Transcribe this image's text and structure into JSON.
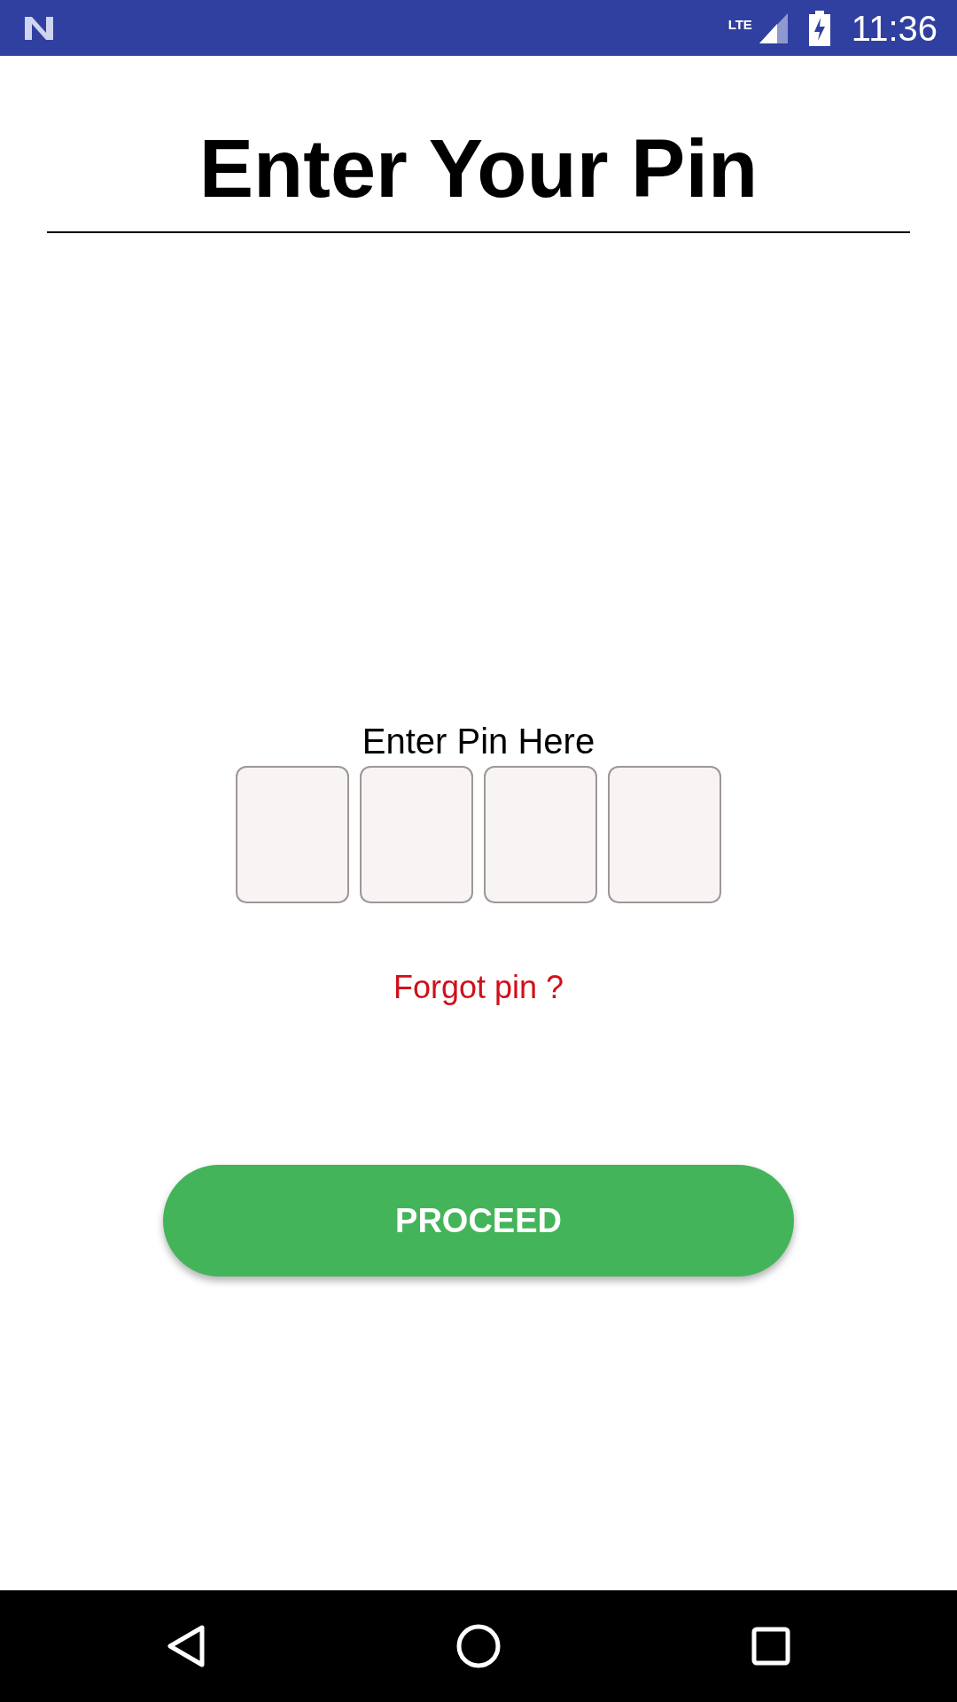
{
  "status_bar": {
    "network": "LTE",
    "time": "11:36"
  },
  "title": "Enter Your Pin",
  "pin_label": "Enter Pin Here",
  "pin_fields": [
    {
      "filled": false
    },
    {
      "filled": false
    },
    {
      "filled": false
    },
    {
      "filled": false
    }
  ],
  "forgot_link": "Forgot pin ?",
  "proceed_button": "PROCEED"
}
